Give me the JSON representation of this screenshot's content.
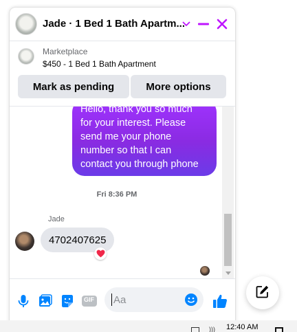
{
  "header": {
    "title": "Jade · 1 Bed 1 Bath Apartm...",
    "accent_color": "#bf15ff"
  },
  "marketplace": {
    "label": "Marketplace",
    "item": "$450 - 1 Bed 1 Bath Apartment",
    "mark_pending_label": "Mark as pending",
    "more_options_label": "More options"
  },
  "messages": {
    "outgoing_lines": [
      "Hello, thank you so much",
      "for your interest. Please",
      "send me your phone",
      "number so that I can",
      "contact you through phone"
    ],
    "timestamp": "Fri 8:36 PM",
    "sender_name": "Jade",
    "incoming_text": "4702407625",
    "reaction": "heart"
  },
  "composer": {
    "placeholder": "Aa",
    "icons": [
      "microphone-icon",
      "photo-icon",
      "sticker-icon",
      "gif-icon",
      "emoji-icon",
      "thumbs-up-icon"
    ],
    "gif_label": "GIF"
  },
  "taskbar": {
    "time": "12:40 AM"
  }
}
